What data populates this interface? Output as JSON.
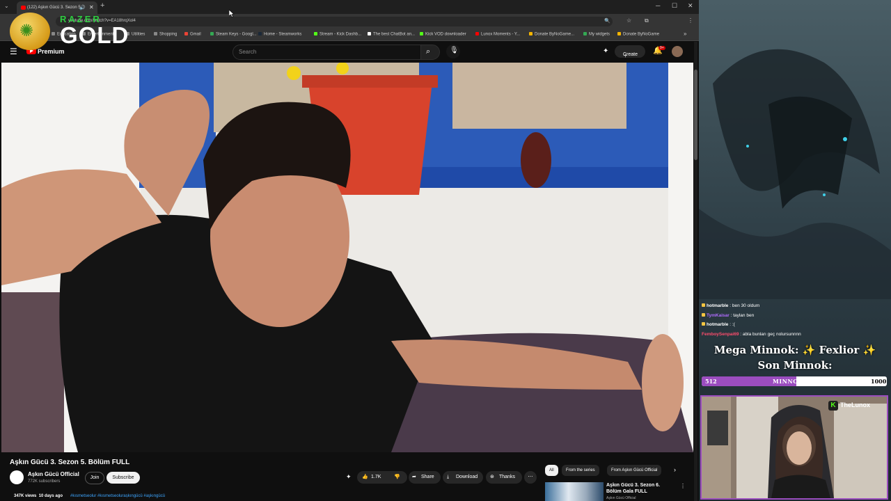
{
  "browser": {
    "tab_title": "(122) Aşkın Gücü 3. Sezon 5...",
    "url": "youtube.com/watch?v=EA18hrqXol4",
    "bookmarks": [
      {
        "label": "Education",
        "color": "#888888"
      },
      {
        "label": "Entertainment",
        "color": "#888888"
      },
      {
        "label": "Utilities",
        "color": "#888888"
      },
      {
        "label": "Shopping",
        "color": "#888888"
      },
      {
        "label": "Gmail",
        "color": "#ea4335"
      },
      {
        "label": "Steam Keys - Googl...",
        "color": "#34a853"
      },
      {
        "label": "Home - Steamworks",
        "color": "#1b2838"
      },
      {
        "label": "Stream - Kick Dashb...",
        "color": "#53fc18"
      },
      {
        "label": "The best ChatBot an...",
        "color": "#ffffff"
      },
      {
        "label": "Kick VOD downloader",
        "color": "#53fc18"
      },
      {
        "label": "Lunox Moments - Y...",
        "color": "#ff0000"
      },
      {
        "label": "Donate ByNoGame...",
        "color": "#f4b400"
      },
      {
        "label": "My widgets",
        "color": "#34a853"
      },
      {
        "label": "Donate ByNoGame",
        "color": "#f4b400"
      }
    ]
  },
  "overlay": {
    "razer_text": "RAZER",
    "gold_text": "GOLD"
  },
  "youtube": {
    "brand": "Premium",
    "search_placeholder": "Search",
    "create_label": "Create",
    "notifications_badge": "9+",
    "video_title": "Aşkın Gücü 3. Sezon 5. Bölüm FULL",
    "channel_name": "Aşkın Gücü Official",
    "subscribers": "772K subscribers",
    "join_label": "Join",
    "subscribe_label": "Subscribe",
    "like_count": "1.7K",
    "share_label": "Share",
    "download_label": "Download",
    "thanks_label": "Thanks",
    "views": "347K views",
    "age": "10 days ago",
    "hashtags": "#kısmetseolur #kısmetseolurașkıngücü #aşkıngücü",
    "chips": [
      "All",
      "From the series",
      "From Aşkın Gücü Official"
    ],
    "next_video_title": "Aşkın Gücü 3. Sezon 6. Bölüm Gala FULL",
    "next_video_channel": "Aşkın Gücü Official"
  },
  "stream": {
    "chat": [
      {
        "user": "hotmarble",
        "text": "ben 30 oldum",
        "color": "#ffffff",
        "badge": true
      },
      {
        "user": "TymKaisar",
        "text": "taylan ben",
        "color": "#b06cff",
        "badge": true
      },
      {
        "user": "hotmarble",
        "text": ":(",
        "color": "#ffffff",
        "badge": true
      },
      {
        "user": "FemboySenpai69",
        "text": "abla bunları geç nolursunnnn",
        "color": "#ff4d6d",
        "badge": false
      }
    ],
    "mega_line": "Mega Minnok: ✨ Fexlior ✨",
    "son_line": "Son Minnok:",
    "goal_current": "512",
    "goal_label": "MINNOKLAR",
    "goal_target": "1000",
    "goal_fraction": 0.512,
    "cam_brand": "TheLunox",
    "cam_brand_letter": "K"
  }
}
